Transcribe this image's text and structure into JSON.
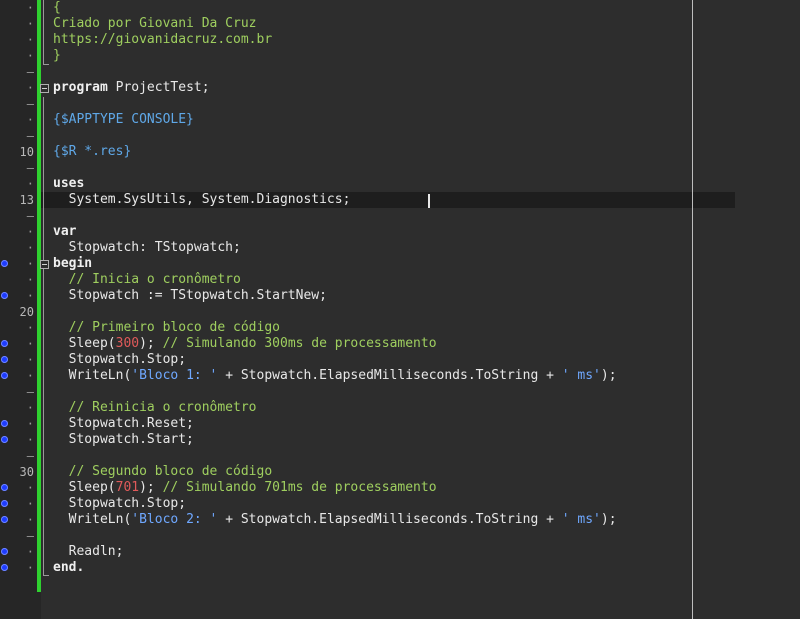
{
  "gutter": {
    "numbers": {
      "10": "10",
      "13": "13",
      "20": "20",
      "30": "30"
    },
    "dot": "·",
    "dash": "–"
  },
  "lines": [
    {
      "n": 1,
      "g": "·",
      "tokens": [
        {
          "t": "{",
          "c": "comment"
        }
      ]
    },
    {
      "n": 2,
      "g": "·",
      "tokens": [
        {
          "t": "Criado por Giovani Da Cruz",
          "c": "comment"
        }
      ]
    },
    {
      "n": 3,
      "g": "·",
      "tokens": [
        {
          "t": "https://giovanidacruz.com.br",
          "c": "comment"
        }
      ]
    },
    {
      "n": 4,
      "g": "·",
      "tokens": [
        {
          "t": "}",
          "c": "comment"
        }
      ]
    },
    {
      "n": 5,
      "g": "–",
      "tokens": []
    },
    {
      "n": 6,
      "g": "·",
      "tokens": [
        {
          "t": "program",
          "c": "keyword"
        },
        {
          "t": " ProjectTest;",
          "c": "plain"
        }
      ]
    },
    {
      "n": 7,
      "g": "–",
      "tokens": []
    },
    {
      "n": 8,
      "g": "·",
      "tokens": [
        {
          "t": "{$APPTYPE CONSOLE}",
          "c": "directive"
        }
      ]
    },
    {
      "n": 9,
      "g": "–",
      "tokens": []
    },
    {
      "n": 10,
      "g": "10",
      "tokens": [
        {
          "t": "{$R *.res}",
          "c": "directive"
        }
      ]
    },
    {
      "n": 11,
      "g": "–",
      "tokens": []
    },
    {
      "n": 12,
      "g": "·",
      "tokens": [
        {
          "t": "uses",
          "c": "keyword"
        }
      ]
    },
    {
      "n": 13,
      "g": "13",
      "tokens": [
        {
          "t": "  System.SysUtils, System.Diagnostics;",
          "c": "plain"
        }
      ]
    },
    {
      "n": 14,
      "g": "–",
      "tokens": []
    },
    {
      "n": 15,
      "g": "·",
      "tokens": [
        {
          "t": "var",
          "c": "keyword"
        }
      ]
    },
    {
      "n": 16,
      "g": "·",
      "tokens": [
        {
          "t": "  Stopwatch: TStopwatch;",
          "c": "plain"
        }
      ]
    },
    {
      "n": 17,
      "g": "·",
      "bp": true,
      "tokens": [
        {
          "t": "begin",
          "c": "keyword"
        }
      ]
    },
    {
      "n": 18,
      "g": "·",
      "tokens": [
        {
          "t": "  // Inicia o cronômetro",
          "c": "comment"
        }
      ]
    },
    {
      "n": 19,
      "g": "·",
      "bp": true,
      "tokens": [
        {
          "t": "  Stopwatch := TStopwatch.StartNew;",
          "c": "plain"
        }
      ]
    },
    {
      "n": 20,
      "g": "20",
      "tokens": []
    },
    {
      "n": 21,
      "g": "·",
      "tokens": [
        {
          "t": "  // Primeiro bloco de código",
          "c": "comment"
        }
      ]
    },
    {
      "n": 22,
      "g": "·",
      "bp": true,
      "tokens": [
        {
          "t": "  Sleep(",
          "c": "plain"
        },
        {
          "t": "300",
          "c": "number"
        },
        {
          "t": "); ",
          "c": "plain"
        },
        {
          "t": "// Simulando 300ms de processamento",
          "c": "comment"
        }
      ]
    },
    {
      "n": 23,
      "g": "·",
      "bp": true,
      "tokens": [
        {
          "t": "  Stopwatch.Stop;",
          "c": "plain"
        }
      ]
    },
    {
      "n": 24,
      "g": "·",
      "bp": true,
      "tokens": [
        {
          "t": "  WriteLn(",
          "c": "plain"
        },
        {
          "t": "'Bloco 1: '",
          "c": "string"
        },
        {
          "t": " + Stopwatch.ElapsedMilliseconds.ToString + ",
          "c": "plain"
        },
        {
          "t": "' ms'",
          "c": "string"
        },
        {
          "t": ");",
          "c": "plain"
        }
      ]
    },
    {
      "n": 25,
      "g": "–",
      "tokens": []
    },
    {
      "n": 26,
      "g": "·",
      "tokens": [
        {
          "t": "  // Reinicia o cronômetro",
          "c": "comment"
        }
      ]
    },
    {
      "n": 27,
      "g": "·",
      "bp": true,
      "tokens": [
        {
          "t": "  Stopwatch.Reset;",
          "c": "plain"
        }
      ]
    },
    {
      "n": 28,
      "g": "·",
      "bp": true,
      "tokens": [
        {
          "t": "  Stopwatch.Start;",
          "c": "plain"
        }
      ]
    },
    {
      "n": 29,
      "g": "–",
      "tokens": []
    },
    {
      "n": 30,
      "g": "30",
      "tokens": [
        {
          "t": "  // Segundo bloco de código",
          "c": "comment"
        }
      ]
    },
    {
      "n": 31,
      "g": "·",
      "bp": true,
      "tokens": [
        {
          "t": "  Sleep(",
          "c": "plain"
        },
        {
          "t": "701",
          "c": "number"
        },
        {
          "t": "); ",
          "c": "plain"
        },
        {
          "t": "// Simulando 701ms de processamento",
          "c": "comment"
        }
      ]
    },
    {
      "n": 32,
      "g": "·",
      "bp": true,
      "tokens": [
        {
          "t": "  Stopwatch.Stop;",
          "c": "plain"
        }
      ]
    },
    {
      "n": 33,
      "g": "·",
      "bp": true,
      "tokens": [
        {
          "t": "  WriteLn(",
          "c": "plain"
        },
        {
          "t": "'Bloco 2: '",
          "c": "string"
        },
        {
          "t": " + Stopwatch.ElapsedMilliseconds.ToString + ",
          "c": "plain"
        },
        {
          "t": "' ms'",
          "c": "string"
        },
        {
          "t": ");",
          "c": "plain"
        }
      ]
    },
    {
      "n": 34,
      "g": "–",
      "tokens": []
    },
    {
      "n": 35,
      "g": "·",
      "bp": true,
      "tokens": [
        {
          "t": "  Readln;",
          "c": "plain"
        }
      ]
    },
    {
      "n": 36,
      "g": "·",
      "bp": true,
      "tokens": [
        {
          "t": "end.",
          "c": "keyword"
        }
      ]
    }
  ],
  "colors": {
    "background": "#2d2d2d",
    "gutter": "#262626",
    "change_bar": "#2fd12f",
    "comment": "#9fcf5f",
    "directive": "#5fa8e8",
    "string": "#6fa8ff",
    "number": "#e05a5a",
    "breakpoint": "#1e3cff"
  },
  "editor": {
    "current_line": 13,
    "fold_markers": [
      "fold-box-program",
      "fold-box-begin"
    ]
  }
}
